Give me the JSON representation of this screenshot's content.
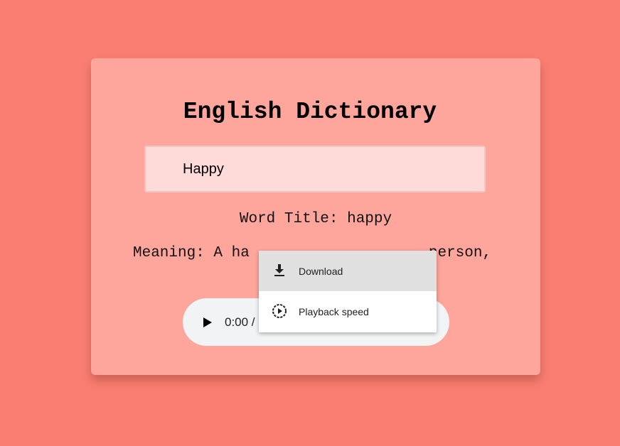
{
  "app": {
    "title": "English Dictionary"
  },
  "search": {
    "value": "Happy",
    "placeholder": ""
  },
  "result": {
    "word_title": "Word Title: happy",
    "meaning": "Meaning: A ha                    person,"
  },
  "audio_player": {
    "time": "0:00 /",
    "play_icon": "play-icon"
  },
  "context_menu": {
    "items": [
      {
        "label": "Download",
        "icon": "download-icon",
        "highlighted": true
      },
      {
        "label": "Playback speed",
        "icon": "playback-speed-icon",
        "highlighted": false
      }
    ]
  },
  "colors": {
    "page_background": "#fa7f72",
    "card_background": "#fea59c",
    "input_background": "#fedad8",
    "player_background": "#f1f3f4",
    "menu_hover": "#e0e0e0"
  }
}
